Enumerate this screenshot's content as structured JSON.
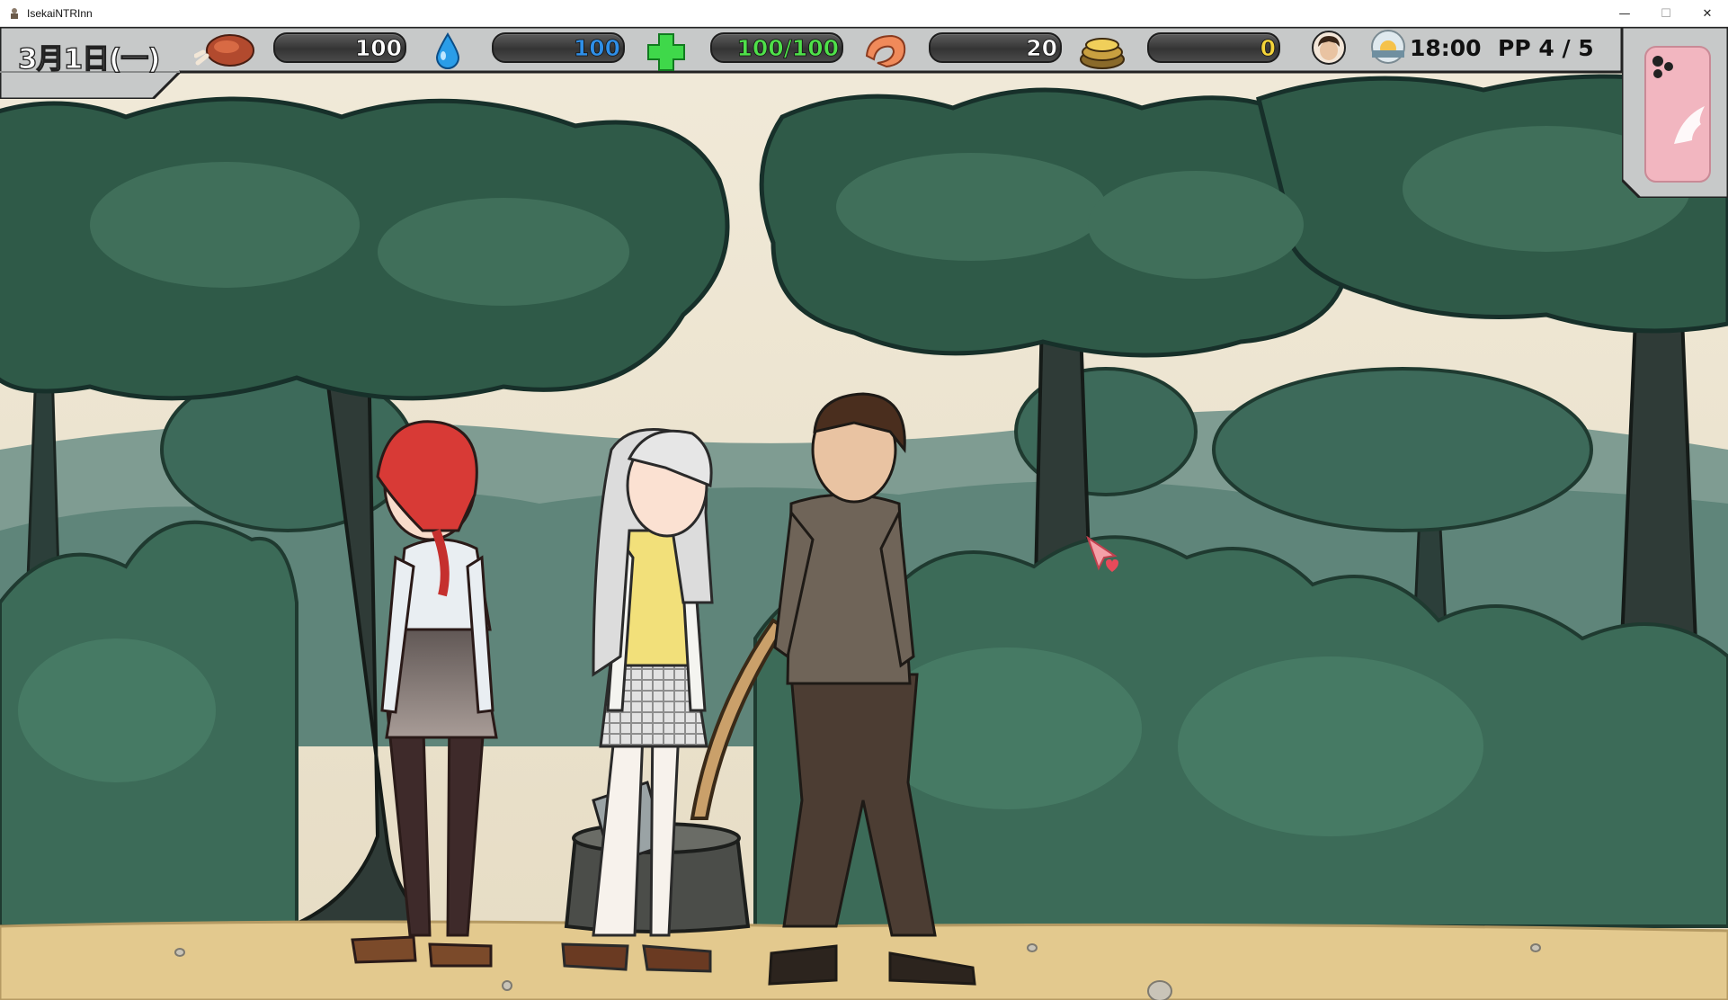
{
  "window": {
    "title": "IsekaiNTRInn",
    "controls": {
      "minimize": "—",
      "maximize": "☐",
      "close": "✕"
    }
  },
  "hud": {
    "date": "3月1日(一)",
    "stats": [
      {
        "icon": "meat-icon",
        "value": "100",
        "color": "#ffffff"
      },
      {
        "icon": "water-drop-icon",
        "value": "100",
        "color": "#2f8fe8"
      },
      {
        "icon": "health-cross-icon",
        "value": "100/100",
        "color": "#4fe04a"
      },
      {
        "icon": "shrimp-icon",
        "value": "20",
        "color": "#ffffff"
      },
      {
        "icon": "gold-coins-icon",
        "value": "0",
        "color": "#f4d43a"
      }
    ],
    "avatar": "player-avatar",
    "time_icon": "sunset-icon",
    "time": "18:00",
    "pp": "PP 4 / 5",
    "phone": "phone-menu-button"
  },
  "scene": {
    "location": "forest-path",
    "characters": [
      "red-haired-girl",
      "silver-haired-girl",
      "brown-haired-man"
    ],
    "objects": [
      "tree-stump-with-axe"
    ]
  },
  "cursor": "heart-pointer-cursor",
  "colors": {
    "sky": "#ece5d3",
    "foliage_dark": "#2f5a48",
    "foliage": "#3f6e56",
    "ground": "#e3c98e",
    "hud_text": "#111111"
  }
}
